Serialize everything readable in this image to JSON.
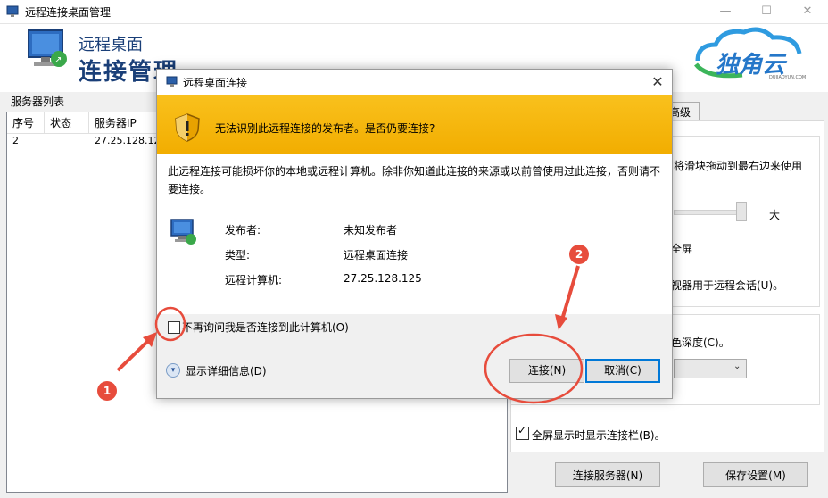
{
  "window": {
    "title": "远程连接桌面管理",
    "minimize": "—",
    "maximize": "☐",
    "close": "✕"
  },
  "banner": {
    "line1": "远程桌面",
    "line2": "连接管理",
    "logo_text": "独角云",
    "logo_sub": "DUJIAOYUN.COM"
  },
  "server_list": {
    "label": "服务器列表",
    "columns": [
      "序号",
      "状态",
      "服务器IP"
    ],
    "rows": [
      {
        "index": "2",
        "status": "",
        "ip": "27.25.128.12"
      }
    ]
  },
  "right_panel": {
    "tab_label": "高级",
    "slider_text": "将滑块拖动到最右边来使用",
    "slider_max_label": "大",
    "fullscreen_text": "全屏",
    "monitors_text": "视器用于远程会话(U)。",
    "color_depth_text": "色深度(C)。",
    "show_bar_label": "全屏显示时显示连接栏(B)。",
    "show_bar_checked": true,
    "connect_server_btn": "连接服务器(N)",
    "save_settings_btn": "保存设置(M)"
  },
  "dialog": {
    "title": "远程桌面连接",
    "close_glyph": "✕",
    "warning": "无法识别此远程连接的发布者。是否仍要连接?",
    "description": "此远程连接可能损坏你的本地或远程计算机。除非你知道此连接的来源或以前曾使用过此连接，否则请不要连接。",
    "fields": [
      {
        "label": "发布者:",
        "value": "未知发布者"
      },
      {
        "label": "类型:",
        "value": "远程桌面连接"
      },
      {
        "label": "远程计算机:",
        "value": "27.25.128.125"
      }
    ],
    "dont_ask_label": "不再询问我是否连接到此计算机(O)",
    "dont_ask_checked": false,
    "details_label": "显示详细信息(D)",
    "connect_btn": "连接(N)",
    "cancel_btn": "取消(C)"
  },
  "annotations": {
    "badge1": "1",
    "badge2": "2",
    "color": "#e74c3c"
  }
}
